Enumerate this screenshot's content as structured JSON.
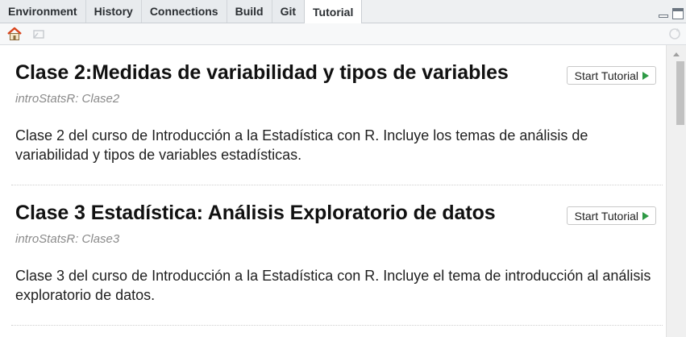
{
  "tabs": [
    {
      "label": "Environment",
      "active": false
    },
    {
      "label": "History",
      "active": false
    },
    {
      "label": "Connections",
      "active": false
    },
    {
      "label": "Build",
      "active": false
    },
    {
      "label": "Git",
      "active": false
    },
    {
      "label": "Tutorial",
      "active": true
    }
  ],
  "toolbar": {
    "icons": [
      "home-icon",
      "clear-icon",
      "refresh-icon"
    ]
  },
  "tutorials": [
    {
      "title": "Clase 2:Medidas de variabilidad y tipos de variables",
      "package": "introStatsR: Clase2",
      "description": "Clase 2 del curso de Introducción a la Estadística con R. Incluye los temas de análisis de variabilidad y tipos de variables estadísticas.",
      "button_label": "Start Tutorial"
    },
    {
      "title": "Clase 3 Estadística: Análisis Exploratorio de datos",
      "package": "introStatsR: Clase3",
      "description": "Clase 3 del curso de Introducción a la Estadística con R. Incluye el tema de introducción al análisis exploratorio de datos.",
      "button_label": "Start Tutorial"
    }
  ],
  "colors": {
    "play": "#2e9a45",
    "home_roof": "#d9441c",
    "tab_bg": "#e8ebee"
  }
}
